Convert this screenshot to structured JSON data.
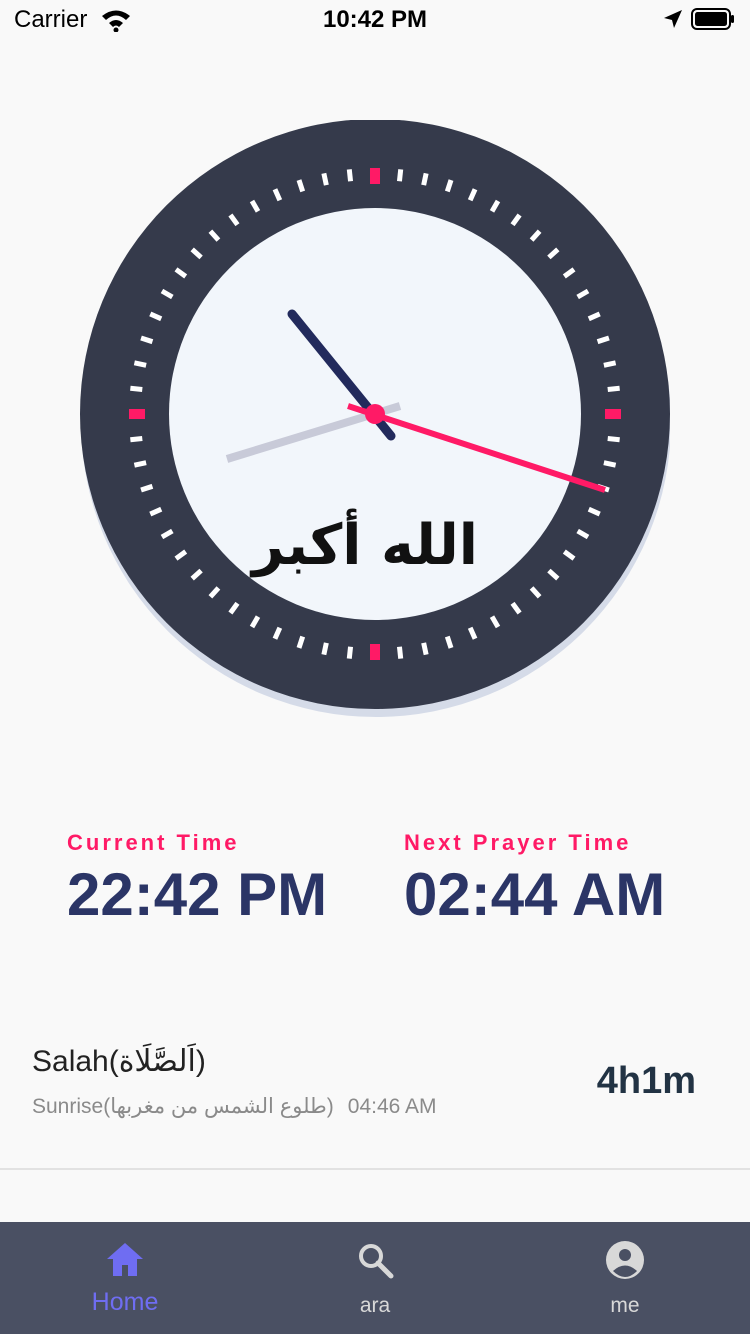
{
  "status": {
    "carrier": "Carrier",
    "time": "10:42 PM"
  },
  "clock": {
    "calligraphy": "الله أكبر"
  },
  "current": {
    "label": "Current Time",
    "value": "22:42 PM"
  },
  "next": {
    "label": "Next Prayer Time",
    "value": "02:44 AM"
  },
  "salah": {
    "title": "Salah(اَلصَّلَاة)",
    "sub_name": "Sunrise(طلوع الشمس من مغربها)",
    "sub_time": "04:46 AM",
    "remaining": "4h1m"
  },
  "tabs": [
    {
      "label": "Home",
      "icon": "home-icon",
      "active": true
    },
    {
      "label": "ara",
      "icon": "search-icon",
      "active": false
    },
    {
      "label": "me",
      "icon": "account-icon",
      "active": false
    }
  ],
  "colors": {
    "accent": "#ff1a66",
    "navy": "#2b3566",
    "tab_active": "#6f6df2",
    "tabbar": "#4a5063"
  }
}
